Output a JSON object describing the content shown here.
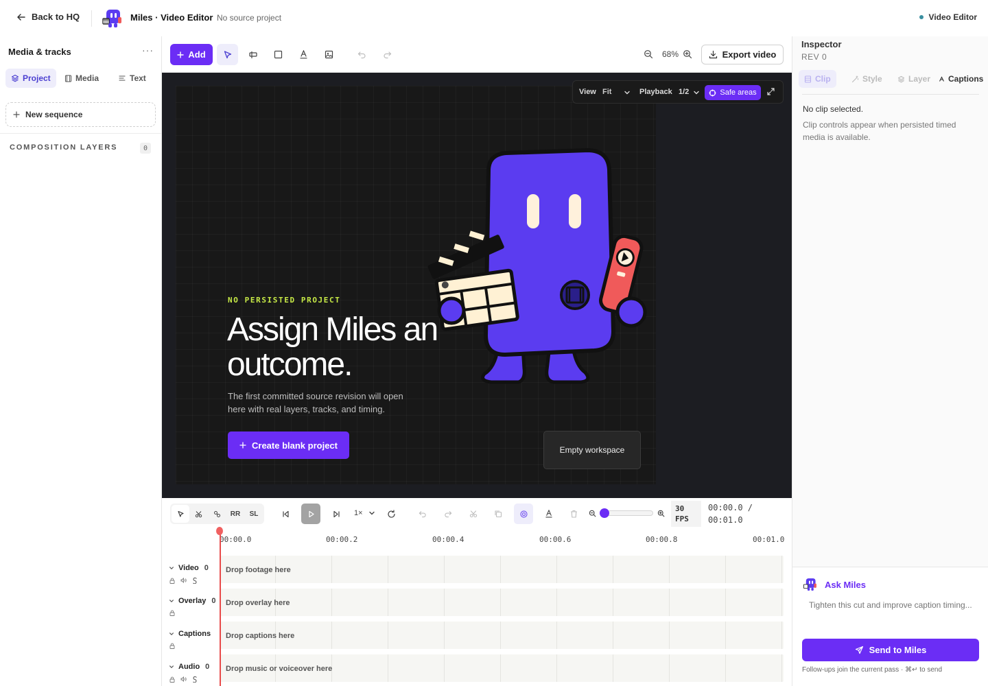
{
  "topbar": {
    "back_label": "Back to HQ",
    "app_title": "Miles · Video Editor",
    "app_subtitle": "No source project",
    "mode_label": "Video Editor"
  },
  "sidebar": {
    "title": "Media & tracks",
    "more": "···",
    "tabs": [
      {
        "label": "Project",
        "icon": "layers-icon",
        "active": true
      },
      {
        "label": "Media",
        "icon": "film-icon",
        "active": false
      },
      {
        "label": "Text",
        "icon": "text-icon",
        "active": false
      }
    ],
    "new_sequence": "New sequence",
    "composition_title": "COMPOSITION LAYERS",
    "composition_count": "0"
  },
  "toolbar": {
    "add_label": "Add",
    "zoom_level": "68%",
    "export_label": "Export video"
  },
  "viewbar": {
    "view_label": "View",
    "view_value": "Fit",
    "playback_label": "Playback",
    "playback_value": "1/2",
    "safe_areas": "Safe areas"
  },
  "hero": {
    "eyebrow": "NO PERSISTED PROJECT",
    "heading": "Assign Miles an outcome.",
    "body": "The first committed source revision will open here with real layers, tracks, and timing.",
    "cta": "Create blank project",
    "empty_badge": "Empty workspace"
  },
  "timeline": {
    "tool_labels": {
      "ripple": "RR",
      "slip": "SL"
    },
    "speed": "1×",
    "fps_value": "30",
    "fps_unit": "FPS",
    "time_current": "00:00.0 /",
    "time_total": "00:01.0",
    "ticks": [
      "00:00.0",
      "00:00.2",
      "00:00.4",
      "00:00.6",
      "00:00.8",
      "00:01.0"
    ],
    "tracks": [
      {
        "name": "Video",
        "count": "0",
        "drop": "Drop footage here"
      },
      {
        "name": "Overlay",
        "count": "0",
        "drop": "Drop overlay here"
      },
      {
        "name": "Captions",
        "count": "",
        "drop": "Drop captions here"
      },
      {
        "name": "Audio",
        "count": "0",
        "drop": "Drop music or voiceover here"
      }
    ]
  },
  "inspector": {
    "title": "Inspector",
    "rev": "REV 0",
    "tabs": [
      {
        "label": "Clip",
        "icon": "clip-icon"
      },
      {
        "label": "Style",
        "icon": "wand-icon"
      },
      {
        "label": "Layer",
        "icon": "layers-icon"
      },
      {
        "label": "Captions",
        "icon": "captions-icon"
      }
    ],
    "empty_title": "No clip selected.",
    "empty_body": "Clip controls appear when persisted timed media is available."
  },
  "ask": {
    "title": "Ask Miles",
    "placeholder": "Tighten this cut and improve caption timing...",
    "send_label": "Send to Miles",
    "hint": "Follow-ups join the current pass · ⌘↵ to send"
  },
  "colors": {
    "accent": "#6b2df5",
    "eyebrow": "#c7ea46",
    "stage_bg": "#1c1d22",
    "mascot_body": "#5b3cf0",
    "playhead": "#e84a4a"
  }
}
